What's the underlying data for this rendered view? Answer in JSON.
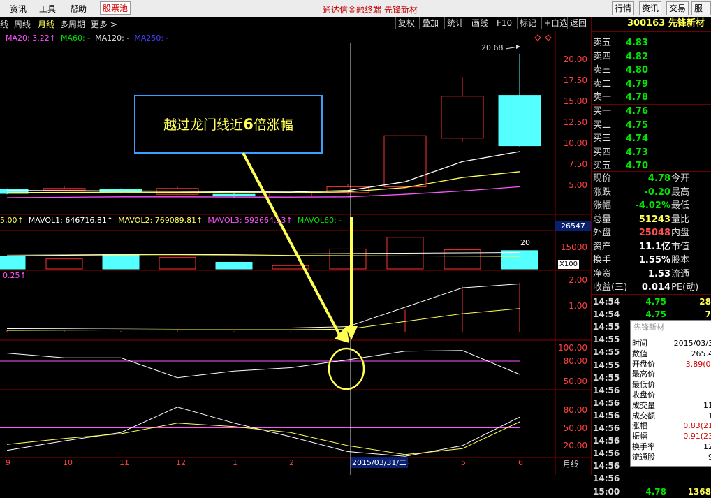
{
  "titlebar": {
    "menus": [
      "资讯",
      "工具",
      "帮助"
    ],
    "active_menu": "股票池",
    "center_title": "通达信金融终端 先锋新材",
    "right_buttons": [
      "行情",
      "资讯",
      "交易",
      "服务"
    ]
  },
  "toolbar": {
    "periods": [
      "线",
      "周线",
      "月线",
      "多周期",
      "更多 >"
    ],
    "selected_period": "月线",
    "buttons": [
      "复权",
      "叠加",
      "统计",
      "画线",
      "F10",
      "标记",
      "+自选",
      "返回"
    ]
  },
  "price_legend": {
    "ma20": "MA20: 3.22↑",
    "ma60": "MA60: -",
    "ma120": "MA120: -",
    "ma250": "MA250: -"
  },
  "volume_legend": {
    "first": "5.00↑",
    "mavol1": "MAVOL1: 646716.81↑",
    "mavol2": "MAVOL2: 769089.81↑",
    "mavol3": "MAVOL3: 592664.13↑",
    "mavol60": "MAVOL60: -",
    "right_value": "26547",
    "unit": "X100",
    "bar_label": "20"
  },
  "indicator_legend": {
    "value": "0.25↑"
  },
  "annotation": {
    "text_pre": "越过龙门线近",
    "text_num": "6",
    "text_post": "倍涨幅",
    "high_label": "20.68"
  },
  "axes": {
    "price_ticks": [
      "20.00",
      "17.50",
      "15.00",
      "12.50",
      "10.00",
      "7.50",
      "5.00"
    ],
    "volume_ticks": [
      "15000"
    ],
    "ind1_ticks": [
      "2.00",
      "1.00"
    ],
    "ind2_ticks": [
      "100.00",
      "80.00",
      "50.00"
    ],
    "ind3_ticks": [
      "80.00",
      "50.00",
      "20.00"
    ],
    "x_labels": [
      "9",
      "10",
      "11",
      "12",
      "1",
      "2",
      "3",
      "4",
      "5",
      "6"
    ],
    "cursor_date": "2015/03/31/二",
    "period_label": "月线"
  },
  "chart_data": {
    "type": "candlestick",
    "categories": [
      "9",
      "10",
      "11",
      "12",
      "1",
      "2",
      "3",
      "4",
      "5",
      "6"
    ],
    "candles": [
      {
        "open": 4.5,
        "close": 4.0,
        "high": 4.6,
        "low": 3.9
      },
      {
        "open": 4.4,
        "close": 4.6,
        "high": 4.9,
        "low": 4.3
      },
      {
        "open": 4.5,
        "close": 4.2,
        "high": 4.6,
        "low": 4.0
      },
      {
        "open": 3.9,
        "close": 4.6,
        "high": 4.8,
        "low": 3.8
      },
      {
        "open": 3.9,
        "close": 3.7,
        "high": 4.0,
        "low": 3.5
      },
      {
        "open": 3.7,
        "close": 4.1,
        "high": 4.2,
        "low": 3.6
      },
      {
        "open": 4.1,
        "close": 4.8,
        "high": 5.1,
        "low": 3.9
      },
      {
        "open": 4.8,
        "close": 10.9,
        "high": 10.9,
        "low": 4.6
      },
      {
        "open": 10.6,
        "close": 15.6,
        "high": 17.9,
        "low": 10.2
      },
      {
        "open": 15.7,
        "close": 9.7,
        "high": 20.68,
        "low": 9.6
      }
    ],
    "ma_white": [
      4.35,
      4.33,
      4.3,
      4.28,
      4.2,
      4.18,
      4.35,
      5.4,
      7.8,
      9.0
    ],
    "ma_yellow": [
      4.1,
      4.12,
      4.15,
      4.14,
      4.1,
      4.08,
      4.2,
      4.7,
      5.9,
      6.6
    ],
    "ma_magenta": [
      3.5,
      3.55,
      3.6,
      3.6,
      3.58,
      3.56,
      3.6,
      3.9,
      4.3,
      4.8
    ],
    "volume": [
      1500,
      1200,
      1700,
      1400,
      800,
      400,
      2400,
      3800,
      2300,
      2200
    ],
    "volume_down": [
      true,
      false,
      false,
      false,
      false,
      true,
      false,
      false,
      false,
      false
    ],
    "ylim": [
      2.5,
      22
    ]
  },
  "quote": {
    "code": "300163",
    "name": "先锋新材",
    "asks": [
      {
        "label": "卖五",
        "price": "4.83"
      },
      {
        "label": "卖四",
        "price": "4.82"
      },
      {
        "label": "卖三",
        "price": "4.80"
      },
      {
        "label": "卖二",
        "price": "4.79"
      },
      {
        "label": "卖一",
        "price": "4.78"
      }
    ],
    "bids": [
      {
        "label": "买一",
        "price": "4.76"
      },
      {
        "label": "买二",
        "price": "4.75"
      },
      {
        "label": "买三",
        "price": "4.74"
      },
      {
        "label": "买四",
        "price": "4.73"
      },
      {
        "label": "买五",
        "price": "4.70"
      }
    ],
    "info": [
      {
        "l1": "现价",
        "v1": "4.78",
        "l2": "今开",
        "c": "green"
      },
      {
        "l1": "涨跌",
        "v1": "-0.20",
        "l2": "最高",
        "c": "green"
      },
      {
        "l1": "涨幅",
        "v1": "-4.02%",
        "l2": "最低",
        "c": "green"
      },
      {
        "l1": "总量",
        "v1": "51243",
        "l2": "量比",
        "c": "yel"
      },
      {
        "l1": "外盘",
        "v1": "25048",
        "l2": "内盘",
        "c": "red"
      },
      {
        "l1": "资产",
        "v1": "11.1亿",
        "l2": "市值",
        "c": "wh"
      },
      {
        "l1": "换手",
        "v1": "1.55%",
        "l2": "股本",
        "c": "wh"
      },
      {
        "l1": "净资",
        "v1": "1.53",
        "l2": "流通",
        "c": "wh"
      },
      {
        "l1": "收益(三)",
        "v1": "0.014",
        "l2": "PE(动)",
        "c": "wh"
      }
    ],
    "ticks": [
      {
        "t": "14:54",
        "p": "4.75",
        "v": "28"
      },
      {
        "t": "14:54",
        "p": "4.75",
        "v": "7"
      },
      {
        "t": "14:55",
        "p": "",
        "v": ""
      },
      {
        "t": "14:55",
        "p": "",
        "v": ""
      },
      {
        "t": "14:55",
        "p": "",
        "v": ""
      },
      {
        "t": "14:55",
        "p": "",
        "v": ""
      },
      {
        "t": "14:55",
        "p": "",
        "v": ""
      },
      {
        "t": "14:56",
        "p": "",
        "v": ""
      },
      {
        "t": "14:56",
        "p": "",
        "v": ""
      },
      {
        "t": "14:56",
        "p": "",
        "v": ""
      },
      {
        "t": "14:56",
        "p": "",
        "v": ""
      },
      {
        "t": "14:56",
        "p": "",
        "v": ""
      },
      {
        "t": "14:56",
        "p": "",
        "v": ""
      },
      {
        "t": "14:56",
        "p": "",
        "v": ""
      },
      {
        "t": "14:56",
        "p": "",
        "v": ""
      },
      {
        "t": "15:00",
        "p": "4.78",
        "v": "1368"
      }
    ]
  },
  "popup": {
    "title": "先锋新材",
    "rows": [
      {
        "l": "时间",
        "v": "2015/03/3"
      },
      {
        "l": "数值",
        "v": "265.4"
      },
      {
        "l": "开盘价",
        "v": "3.89(0."
      },
      {
        "l": "最高价",
        "v": ""
      },
      {
        "l": "最低价",
        "v": ""
      },
      {
        "l": "收盘价",
        "v": ""
      },
      {
        "l": "成交量",
        "v": "11"
      },
      {
        "l": "成交额",
        "v": "1"
      },
      {
        "l": "涨幅",
        "v": "0.83(21"
      },
      {
        "l": "振幅",
        "v": "0.91(23"
      },
      {
        "l": "换手率",
        "v": "12"
      },
      {
        "l": "流通股",
        "v": "9"
      }
    ]
  },
  "colors": {
    "up": "#ff3232",
    "down": "#54ffff",
    "ma_white": "#ffffff",
    "ma_yellow": "#ffff54",
    "ma_magenta": "#ff54ff",
    "annotation_box": "#3aa0ff",
    "annotation_text": "#ffff54"
  }
}
